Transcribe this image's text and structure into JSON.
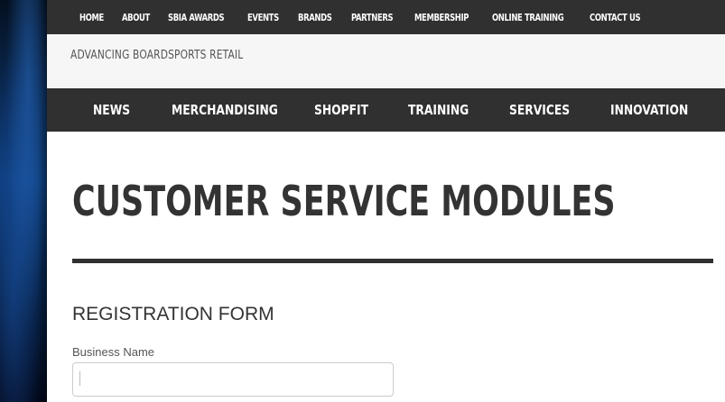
{
  "top_nav": {
    "items": [
      {
        "label": "HOME"
      },
      {
        "label": "ABOUT"
      },
      {
        "label": "SBIA AWARDS"
      },
      {
        "label": "EVENTS"
      },
      {
        "label": "BRANDS"
      },
      {
        "label": "PARTNERS"
      },
      {
        "label": "MEMBERSHIP"
      },
      {
        "label": "ONLINE TRAINING"
      },
      {
        "label": "CONTACT US"
      }
    ]
  },
  "header": {
    "tagline": "ADVANCING BOARDSPORTS RETAIL"
  },
  "main_nav": {
    "items": [
      {
        "label": "NEWS"
      },
      {
        "label": "MERCHANDISING"
      },
      {
        "label": "SHOPFIT"
      },
      {
        "label": "TRAINING"
      },
      {
        "label": "SERVICES"
      },
      {
        "label": "INNOVATION"
      }
    ]
  },
  "content": {
    "page_title": "CUSTOMER SERVICE MODULES",
    "form_heading": "REGISTRATION FORM",
    "fields": [
      {
        "label": "Business Name",
        "value": "",
        "placeholder": ""
      }
    ]
  },
  "colors": {
    "nav_bg": "#303030",
    "tagline_bg": "#f6f6f6",
    "title_text": "#333333"
  }
}
